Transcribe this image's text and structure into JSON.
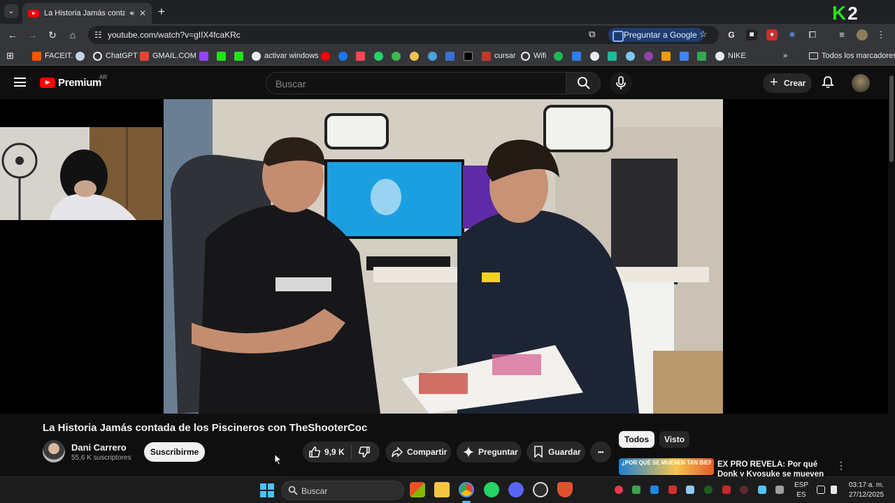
{
  "browser": {
    "tab_title": "La Historia Jamás contada de",
    "url": "youtube.com/watch?v=gIIX4fcaKRc",
    "ask_google_label": "Preguntar a Google",
    "bookmarks": [
      "FACEIT.",
      "ChatGPT",
      "GMAIL.COM",
      "activar windows",
      "cursar",
      "Wifi",
      "NIKE"
    ],
    "all_bookmarks_label": "Todos los marcadores",
    "overflow_label": "»"
  },
  "badge": {
    "letter": "K",
    "number": "2"
  },
  "youtube": {
    "logo_text": "Premium",
    "country_code": "AR",
    "search_placeholder": "Buscar",
    "create_label": "Crear"
  },
  "video": {
    "title": "La Historia Jamás contada de los Piscineros con TheShooterCoc",
    "channel_name": "Dani Carrero",
    "subscribers": "55,6 K suscriptores",
    "subscribe_label": "Suscribirme",
    "like_count": "9,9 K",
    "share_label": "Compartir",
    "ask_label": "Preguntar",
    "save_label": "Guardar",
    "more_label": "•••"
  },
  "recommendations": {
    "chips": [
      "Todos",
      "Visto"
    ],
    "active_chip": "Todos",
    "first_title": "EX PRO REVELA: Por qué Donk y Kyosuke se mueven como",
    "first_thumb_text": "¿POR QUÉ SE MUEVEN TAN BIEN?!"
  },
  "taskbar": {
    "search_placeholder": "Buscar",
    "lang_top": "ESP",
    "lang_bottom": "ES",
    "time": "03:17 a. m.",
    "date": "27/12/2025"
  },
  "colors": {
    "youtube_red": "#ff0000",
    "page_bg": "#0f0f0f",
    "k2_green": "#23e21b",
    "ask_google_bg": "#1f3c6e"
  }
}
